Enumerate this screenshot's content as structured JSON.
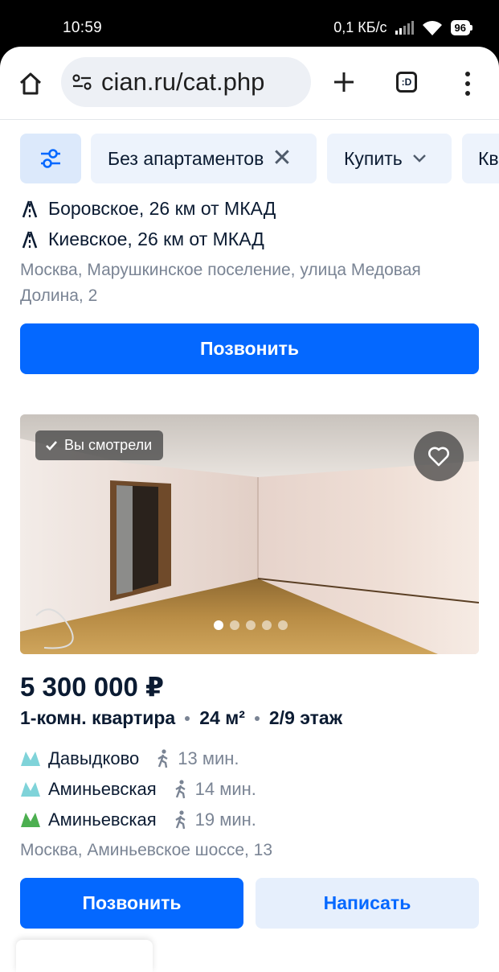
{
  "status_bar": {
    "time": "10:59",
    "network_speed": "0,1 КБ/с",
    "battery": "96"
  },
  "browser": {
    "url": "cian.ru/cat.php",
    "icons": [
      "home-icon",
      "site-settings-icon",
      "new-tab-icon",
      "tab-switcher-icon",
      "menu-icon"
    ],
    "tab_switcher_label": ":D"
  },
  "filters": {
    "chips": [
      {
        "label": "Без апартаментов",
        "removable": true
      },
      {
        "label": "Купить",
        "dropdown": true
      },
      {
        "label": "Кв"
      }
    ]
  },
  "listing_top": {
    "highways": [
      {
        "label": "Боровское, 26 км от МКАД"
      },
      {
        "label": "Киевское, 26 км от МКАД"
      }
    ],
    "address": "Москва, Марушкинское поселение, улица Медовая Долина, 2",
    "call_button": "Позвонить"
  },
  "listing": {
    "seen_badge": "Вы смотрели",
    "photo_count": 5,
    "active_photo": 1,
    "price": "5 300 000 ₽",
    "type": "1-комн. квартира",
    "area": "24 м²",
    "floor": "2/9 этаж",
    "metro": [
      {
        "station": "Давыдково",
        "walk": "13 мин.",
        "line_color": "#7fd3d9"
      },
      {
        "station": "Аминьевская",
        "walk": "14 мин.",
        "line_color": "#7fd3d9"
      },
      {
        "station": "Аминьевская",
        "walk": "19 мин.",
        "line_color": "#4caf50"
      }
    ],
    "address": "Москва, Аминьевское шоссе, 13",
    "call_button": "Позвонить",
    "message_button": "Написать"
  },
  "colors": {
    "primary": "#0468ff",
    "secondary_bg": "#e6effc",
    "chip_bg": "#edf3fc",
    "muted_text": "#7a8494"
  }
}
